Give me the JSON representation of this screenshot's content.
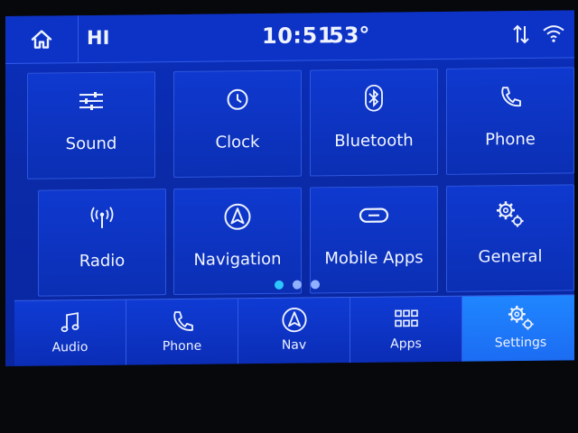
{
  "header": {
    "greeting": "HI",
    "time": "10:51",
    "temperature": "53°",
    "icons": [
      "home-icon",
      "sync-arrows-icon",
      "wifi-icon"
    ]
  },
  "tiles": [
    {
      "label": "Sound",
      "icon": "equalizer-icon"
    },
    {
      "label": "Clock",
      "icon": "clock-icon"
    },
    {
      "label": "Bluetooth",
      "icon": "bluetooth-icon"
    },
    {
      "label": "Phone",
      "icon": "phone-icon"
    },
    {
      "label": "Radio",
      "icon": "radio-antenna-icon"
    },
    {
      "label": "Navigation",
      "icon": "navigation-icon"
    },
    {
      "label": "Mobile Apps",
      "icon": "link-icon"
    },
    {
      "label": "General",
      "icon": "gears-icon"
    }
  ],
  "pagination": {
    "pages": 3,
    "current": 1
  },
  "bottom_nav": [
    {
      "label": "Audio",
      "icon": "music-note-icon"
    },
    {
      "label": "Phone",
      "icon": "phone-icon"
    },
    {
      "label": "Nav",
      "icon": "navigation-icon"
    },
    {
      "label": "Apps",
      "icon": "apps-grid-icon"
    },
    {
      "label": "Settings",
      "icon": "gears-icon",
      "active": true
    }
  ],
  "colors": {
    "background": "#0a2aa8",
    "tile": "#0f39cf",
    "active_tab": "#1f86ff",
    "active_dot": "#2ec6ff"
  }
}
